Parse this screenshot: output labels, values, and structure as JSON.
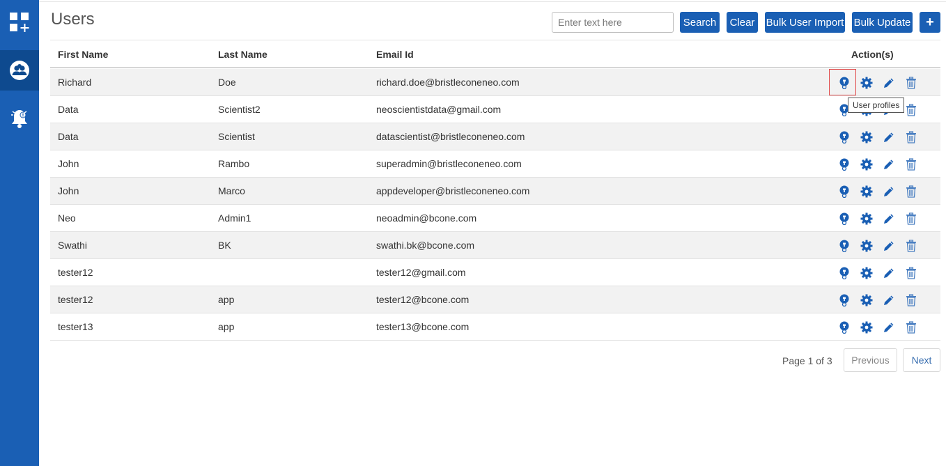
{
  "page": {
    "title": "Users"
  },
  "search": {
    "placeholder": "Enter text here",
    "value": ""
  },
  "toolbar": {
    "search_label": "Search",
    "clear_label": "Clear",
    "bulk_import_label": "Bulk User Import",
    "bulk_update_label": "Bulk Update",
    "add_label": "+"
  },
  "sidebar": {
    "items": [
      {
        "icon": "apps-grid-icon"
      },
      {
        "icon": "users-group-icon",
        "active": true
      },
      {
        "icon": "notification-bell-icon"
      }
    ]
  },
  "table": {
    "headers": {
      "first": "First Name",
      "last": "Last Name",
      "email": "Email Id",
      "actions": "Action(s)"
    },
    "rows": [
      {
        "first": "Richard",
        "last": "Doe",
        "email": "richard.doe@bristleconeneo.com"
      },
      {
        "first": "Data",
        "last": "Scientist2",
        "email": "neoscientistdata@gmail.com"
      },
      {
        "first": "Data",
        "last": "Scientist",
        "email": "datascientist@bristleconeneo.com"
      },
      {
        "first": "John",
        "last": "Rambo",
        "email": "superadmin@bristleconeneo.com"
      },
      {
        "first": "John",
        "last": "Marco",
        "email": "appdeveloper@bristleconeneo.com"
      },
      {
        "first": "Neo",
        "last": "Admin1",
        "email": "neoadmin@bcone.com"
      },
      {
        "first": "Swathi",
        "last": "BK",
        "email": "swathi.bk@bcone.com"
      },
      {
        "first": "tester12",
        "last": "",
        "email": "tester12@gmail.com"
      },
      {
        "first": "tester12",
        "last": "app",
        "email": "tester12@bcone.com"
      },
      {
        "first": "tester13",
        "last": "app",
        "email": "tester13@bcone.com"
      }
    ],
    "action_icons": [
      "user-profile-icon",
      "settings-gear-icon",
      "edit-pencil-icon",
      "delete-trash-icon"
    ]
  },
  "tooltip": {
    "text": "User profiles"
  },
  "pagination": {
    "info": "Page 1 of 3",
    "prev_label": "Previous",
    "next_label": "Next"
  },
  "colors": {
    "primary": "#1a5fb4",
    "sidebar_active": "#0e4a8f",
    "highlight": "#e04848"
  }
}
